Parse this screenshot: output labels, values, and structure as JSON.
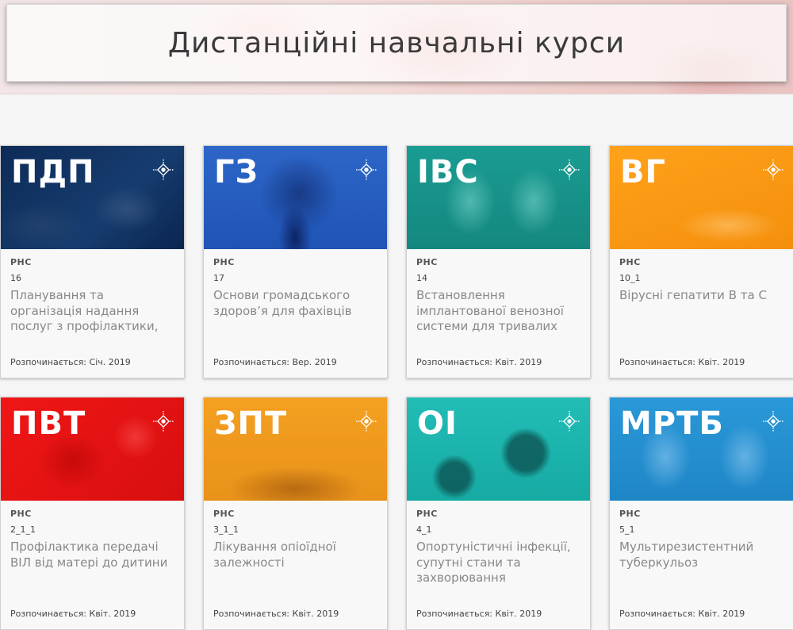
{
  "page": {
    "title": "Дистанційні навчальні курси"
  },
  "courses": [
    {
      "abbr": "ПДП",
      "org": "РНС",
      "code": "16",
      "name": "Планування та організація надання послуг з профілактики,",
      "starts": "Розпочинається: Січ. 2019",
      "color": "#0e2b57"
    },
    {
      "abbr": "ГЗ",
      "org": "РНС",
      "code": "17",
      "name": "Основи громадського здоров’я для фахівців",
      "starts": "Розпочинається: Вер. 2019",
      "color": "#2d66c8"
    },
    {
      "abbr": "ІВС",
      "org": "РНС",
      "code": "14",
      "name": "Встановлення імплантованої венозної системи для тривалих",
      "starts": "Розпочинається: Квіт. 2019",
      "color": "#1a9c92"
    },
    {
      "abbr": "ВГ",
      "org": "РНС",
      "code": "10_1",
      "name": "Вірусні гепатити В та С",
      "starts": "Розпочинається: Квіт. 2019",
      "color": "#ffa21a"
    },
    {
      "abbr": "ПВТ",
      "org": "РНС",
      "code": "2_1_1",
      "name": "Профілактика передачі ВІЛ від матері до дитини",
      "starts": "Розпочинається: Квіт. 2019",
      "color": "#f01616"
    },
    {
      "abbr": "ЗПТ",
      "org": "РНС",
      "code": "3_1_1",
      "name": "Лікування опіоїдної залежності",
      "starts": "Розпочинається: Квіт. 2019",
      "color": "#f4a020"
    },
    {
      "abbr": "ОІ",
      "org": "РНС",
      "code": "4_1",
      "name": "Опортуністичні інфекції, супутні стани та захворювання",
      "starts": "Розпочинається: Квіт. 2019",
      "color": "#22bdb6"
    },
    {
      "abbr": "МРТБ",
      "org": "РНС",
      "code": "5_1",
      "name": "Мультирезистентний туберкульоз",
      "starts": "Розпочинається: Квіт. 2019",
      "color": "#2a98d8"
    }
  ]
}
